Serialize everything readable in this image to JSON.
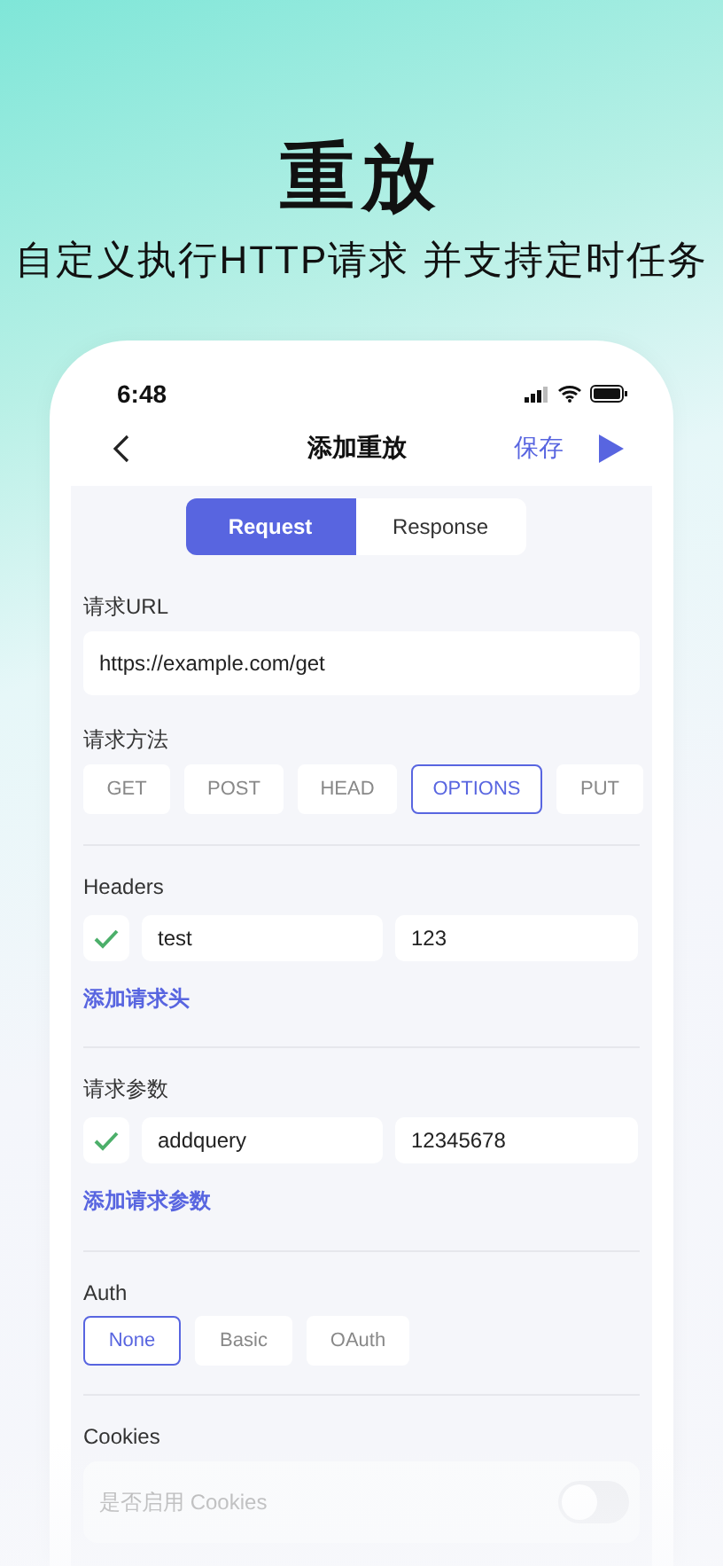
{
  "hero": {
    "title": "重放",
    "subtitle": "自定义执行HTTP请求 并支持定时任务"
  },
  "status_bar": {
    "time": "6:48"
  },
  "nav": {
    "title": "添加重放",
    "save": "保存"
  },
  "segments": [
    {
      "label": "Request",
      "selected": true
    },
    {
      "label": "Response",
      "selected": false
    }
  ],
  "url": {
    "label": "请求URL",
    "value": "https://example.com/get"
  },
  "method": {
    "label": "请求方法",
    "options": [
      {
        "label": "GET",
        "selected": false
      },
      {
        "label": "POST",
        "selected": false
      },
      {
        "label": "HEAD",
        "selected": false
      },
      {
        "label": "OPTIONS",
        "selected": true
      },
      {
        "label": "PUT",
        "selected": false
      }
    ]
  },
  "headers": {
    "label": "Headers",
    "rows": [
      {
        "checked": true,
        "key": "test",
        "value": "123"
      }
    ],
    "add": "添加请求头"
  },
  "params": {
    "label": "请求参数",
    "rows": [
      {
        "checked": true,
        "key": "addquery",
        "value": "12345678"
      }
    ],
    "add": "添加请求参数"
  },
  "auth": {
    "label": "Auth",
    "options": [
      {
        "label": "None",
        "selected": true
      },
      {
        "label": "Basic",
        "selected": false
      },
      {
        "label": "OAuth",
        "selected": false
      }
    ]
  },
  "cookies": {
    "label": "Cookies",
    "toggle_label": "是否启用 Cookies",
    "on": false
  }
}
